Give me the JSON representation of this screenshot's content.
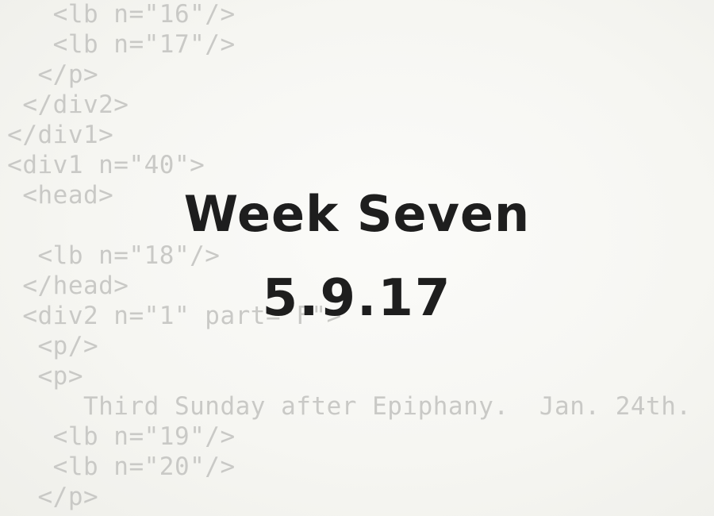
{
  "background_code": [
    "    <lb n=\"16\"/>",
    "    <lb n=\"17\"/>",
    "   </p>",
    "  </div2>",
    " </div1>",
    " <div1 n=\"40\">",
    "  <head>",
    "",
    "   <lb n=\"18\"/>",
    "  </head>",
    "  <div2 n=\"1\" part=\"F\">",
    "   <p/>",
    "   <p>",
    "      Third Sunday after Epiphany.  Jan. 24th.",
    "    <lb n=\"19\"/>",
    "    <lb n=\"20\"/>",
    "   </p>"
  ],
  "title": {
    "week": "Week Seven",
    "date": "5.9.17"
  },
  "colors": {
    "background": "#f7f7f4",
    "code_text": "#c9c9c6",
    "title_text": "#1e1e1e"
  }
}
